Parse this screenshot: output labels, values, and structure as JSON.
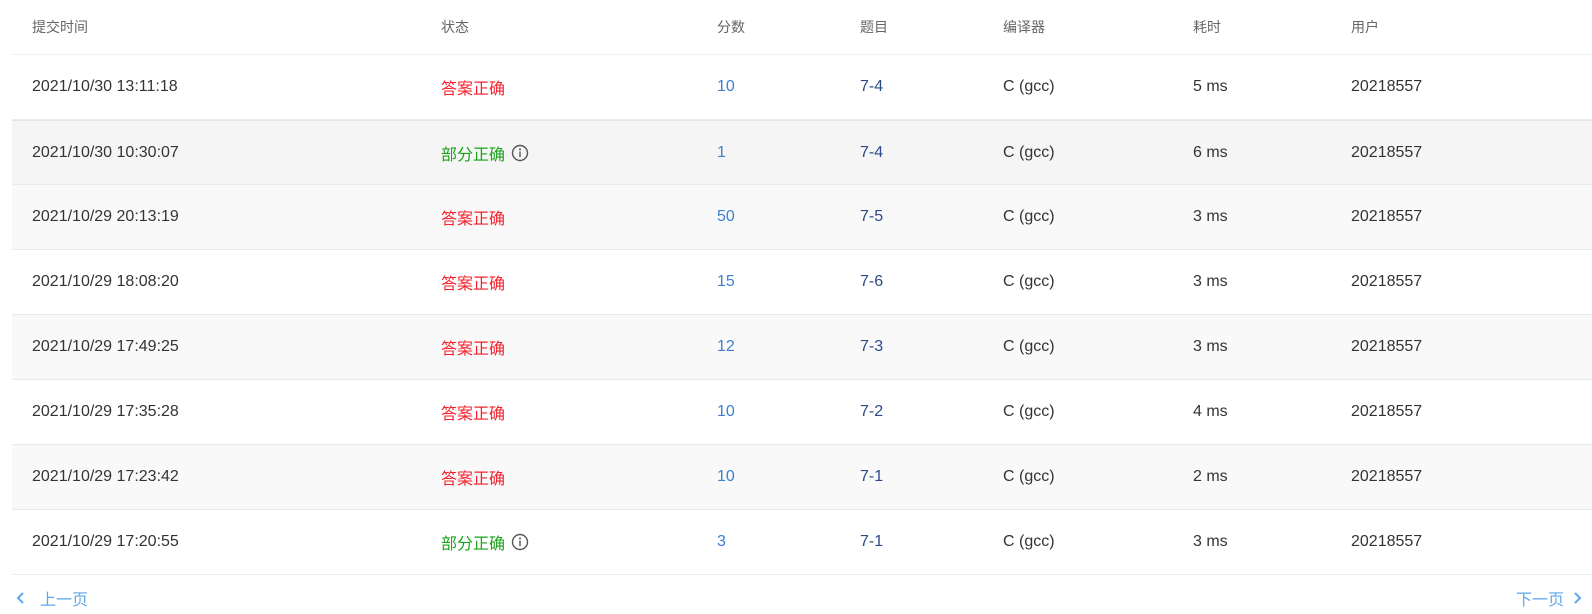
{
  "columns": {
    "time": "提交时间",
    "status": "状态",
    "score": "分数",
    "problem": "题目",
    "compiler": "编译器",
    "cost": "耗时",
    "user": "用户"
  },
  "rows": [
    {
      "time": "2021/10/30 13:11:18",
      "status": "答案正确",
      "status_type": "ok",
      "score": "10",
      "problem": "7-4",
      "compiler": "C (gcc)",
      "cost": "5 ms",
      "user": "20218557"
    },
    {
      "time": "2021/10/30 10:30:07",
      "status": "部分正确",
      "status_type": "partial",
      "score": "1",
      "problem": "7-4",
      "compiler": "C (gcc)",
      "cost": "6 ms",
      "user": "20218557"
    },
    {
      "time": "2021/10/29 20:13:19",
      "status": "答案正确",
      "status_type": "ok",
      "score": "50",
      "problem": "7-5",
      "compiler": "C (gcc)",
      "cost": "3 ms",
      "user": "20218557"
    },
    {
      "time": "2021/10/29 18:08:20",
      "status": "答案正确",
      "status_type": "ok",
      "score": "15",
      "problem": "7-6",
      "compiler": "C (gcc)",
      "cost": "3 ms",
      "user": "20218557"
    },
    {
      "time": "2021/10/29 17:49:25",
      "status": "答案正确",
      "status_type": "ok",
      "score": "12",
      "problem": "7-3",
      "compiler": "C (gcc)",
      "cost": "3 ms",
      "user": "20218557"
    },
    {
      "time": "2021/10/29 17:35:28",
      "status": "答案正确",
      "status_type": "ok",
      "score": "10",
      "problem": "7-2",
      "compiler": "C (gcc)",
      "cost": "4 ms",
      "user": "20218557"
    },
    {
      "time": "2021/10/29 17:23:42",
      "status": "答案正确",
      "status_type": "ok",
      "score": "10",
      "problem": "7-1",
      "compiler": "C (gcc)",
      "cost": "2 ms",
      "user": "20218557"
    },
    {
      "time": "2021/10/29 17:20:55",
      "status": "部分正确",
      "status_type": "partial",
      "score": "3",
      "problem": "7-1",
      "compiler": "C (gcc)",
      "cost": "3 ms",
      "user": "20218557"
    }
  ],
  "pagination": {
    "prev_label": "上一页",
    "next_label": "下一页"
  },
  "colors": {
    "status_ok": "#f5222d",
    "status_partial": "#19a319",
    "score": "#3d7fd1",
    "problem": "#2b4a87",
    "pager": "#5fa7ee"
  }
}
